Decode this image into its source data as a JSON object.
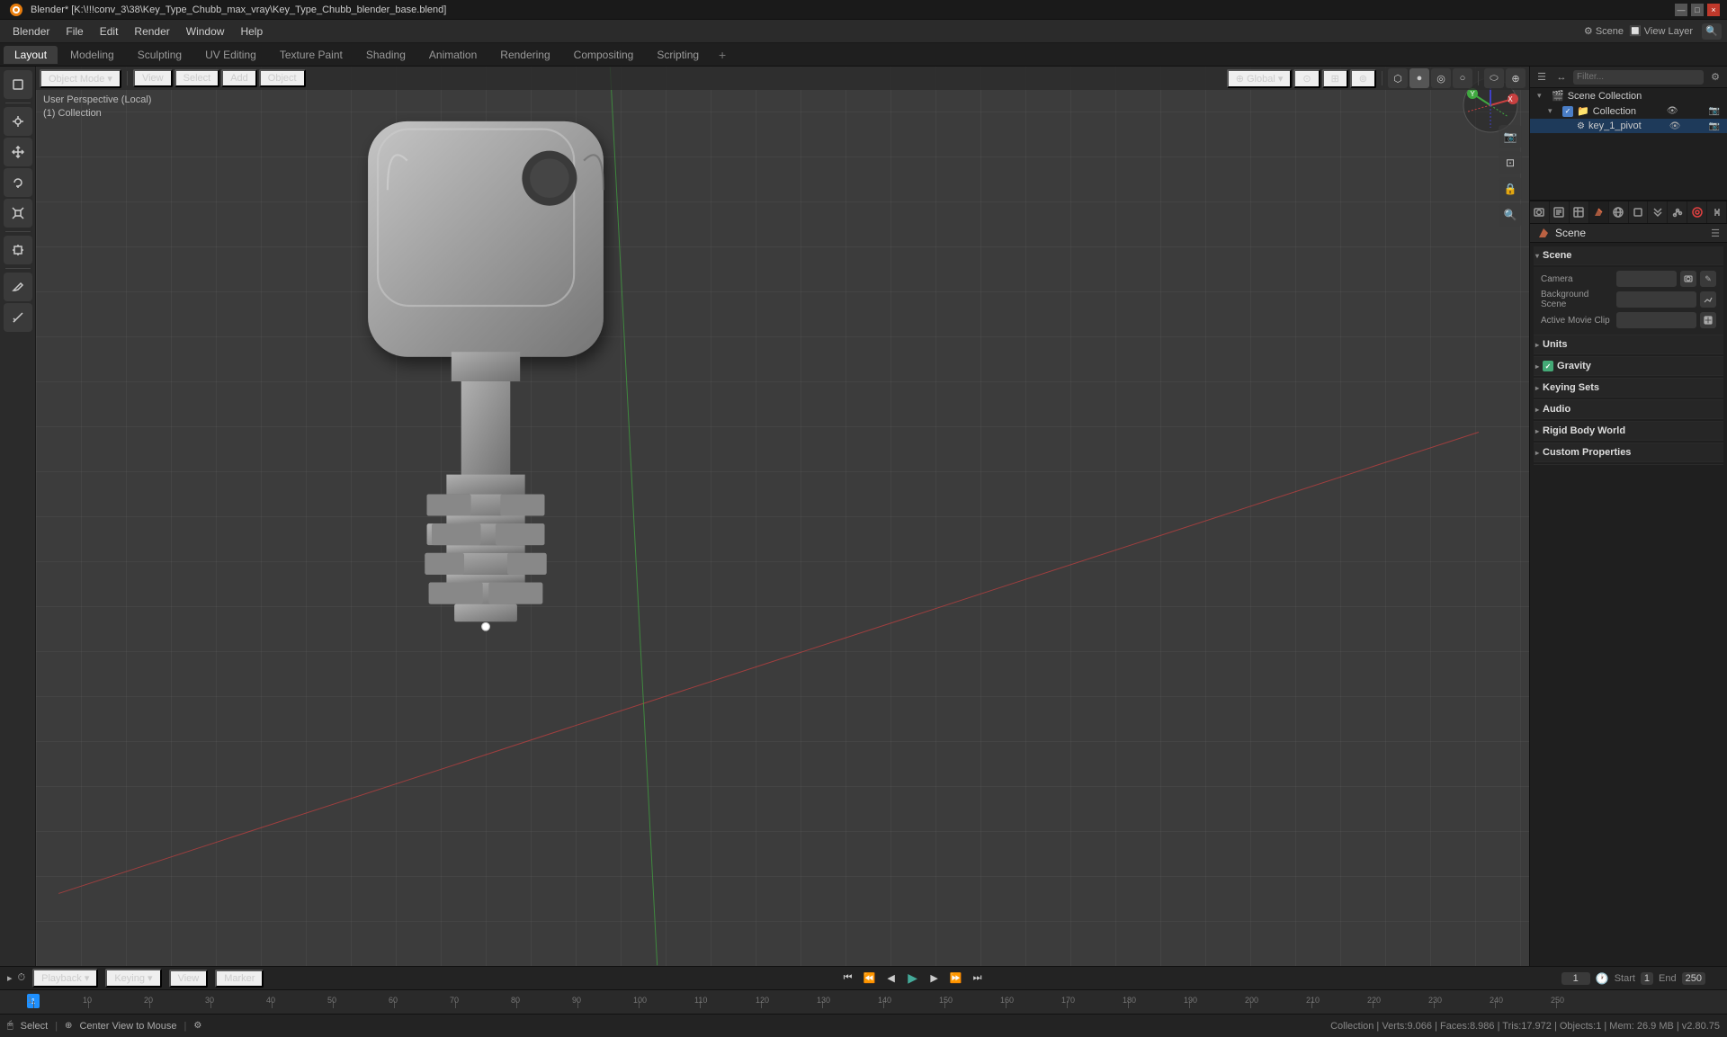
{
  "titlebar": {
    "title": "Blender* [K:\\!!!conv_3\\38\\Key_Type_Chubb_max_vray\\Key_Type_Chubb_blender_base.blend]",
    "controls": [
      "—",
      "□",
      "×"
    ]
  },
  "menubar": {
    "items": [
      "Blender",
      "File",
      "Edit",
      "Render",
      "Window",
      "Help"
    ]
  },
  "workspace_tabs": {
    "tabs": [
      "Layout",
      "Modeling",
      "Sculpting",
      "UV Editing",
      "Texture Paint",
      "Shading",
      "Animation",
      "Rendering",
      "Compositing",
      "Scripting"
    ],
    "active": "Layout",
    "plus_label": "+"
  },
  "viewport": {
    "mode_label": "Object Mode",
    "perspective_line1": "User Perspective (Local)",
    "perspective_line2": "(1) Collection",
    "menus": [
      "View",
      "Select",
      "Add",
      "Object"
    ],
    "shading_modes": [
      "◈",
      "◉",
      "●",
      "□"
    ],
    "active_shading": 2,
    "viewport_overlays_label": "Viewport Overlays",
    "gizmo_label": "Gizmo"
  },
  "outliner": {
    "header_label": "Scene Collection",
    "items": [
      {
        "indent": 0,
        "icon": "▸",
        "label": "Scene Collection",
        "type": "scene"
      },
      {
        "indent": 1,
        "icon": "▸",
        "label": "Collection",
        "type": "collection",
        "checked": true
      },
      {
        "indent": 2,
        "icon": "⚙",
        "label": "key_1_pivot",
        "type": "object"
      }
    ]
  },
  "properties": {
    "panel_title": "Scene",
    "tab_icon": "🎬",
    "sections": [
      {
        "id": "scene",
        "title": "Scene",
        "expanded": true,
        "fields": [
          {
            "label": "Camera",
            "value": "",
            "has_icon": true,
            "icon": "📷"
          },
          {
            "label": "Background Scene",
            "value": "",
            "has_icon": true,
            "icon": "🎬"
          },
          {
            "label": "Active Movie Clip",
            "value": "",
            "has_icon": true,
            "icon": "🎞"
          }
        ]
      },
      {
        "id": "units",
        "title": "Units",
        "expanded": false,
        "fields": []
      },
      {
        "id": "gravity",
        "title": "Gravity",
        "expanded": false,
        "checkbox": true,
        "fields": []
      },
      {
        "id": "keying_sets",
        "title": "Keying Sets",
        "expanded": false,
        "fields": []
      },
      {
        "id": "audio",
        "title": "Audio",
        "expanded": false,
        "fields": []
      },
      {
        "id": "rigid_body_world",
        "title": "Rigid Body World",
        "expanded": false,
        "fields": []
      },
      {
        "id": "custom_properties",
        "title": "Custom Properties",
        "expanded": false,
        "fields": []
      }
    ]
  },
  "timeline": {
    "playback_label": "Playback",
    "keying_label": "Keying",
    "view_label": "View",
    "marker_label": "Marker",
    "frame_current": "1",
    "frame_start_label": "Start",
    "frame_start": "1",
    "frame_end_label": "End",
    "frame_end": "250",
    "ruler_ticks": [
      "1",
      "10",
      "20",
      "30",
      "40",
      "50",
      "60",
      "70",
      "80",
      "90",
      "100",
      "110",
      "120",
      "130",
      "140",
      "150",
      "160",
      "170",
      "180",
      "190",
      "200",
      "210",
      "220",
      "230",
      "240",
      "250"
    ]
  },
  "statusbar": {
    "select_label": "Select",
    "center_view_label": "Center View to Mouse",
    "stats": "Collection | Verts:9.066 | Faces:8.986 | Tris:17.972 | Objects:1 | Mem: 26.9 MB | v2.80.75"
  },
  "prop_tabs": [
    {
      "id": "render",
      "icon": "📷",
      "label": "Render"
    },
    {
      "id": "output",
      "icon": "🖨",
      "label": "Output"
    },
    {
      "id": "view_layer",
      "icon": "🔲",
      "label": "View Layer"
    },
    {
      "id": "scene",
      "icon": "🎬",
      "label": "Scene",
      "active": true
    },
    {
      "id": "world",
      "icon": "🌐",
      "label": "World"
    },
    {
      "id": "object",
      "icon": "▽",
      "label": "Object"
    },
    {
      "id": "modifiers",
      "icon": "🔧",
      "label": "Modifiers"
    },
    {
      "id": "particles",
      "icon": "✦",
      "label": "Particles"
    },
    {
      "id": "physics",
      "icon": "🔵",
      "label": "Physics"
    },
    {
      "id": "constraints",
      "icon": "🔗",
      "label": "Constraints"
    }
  ]
}
